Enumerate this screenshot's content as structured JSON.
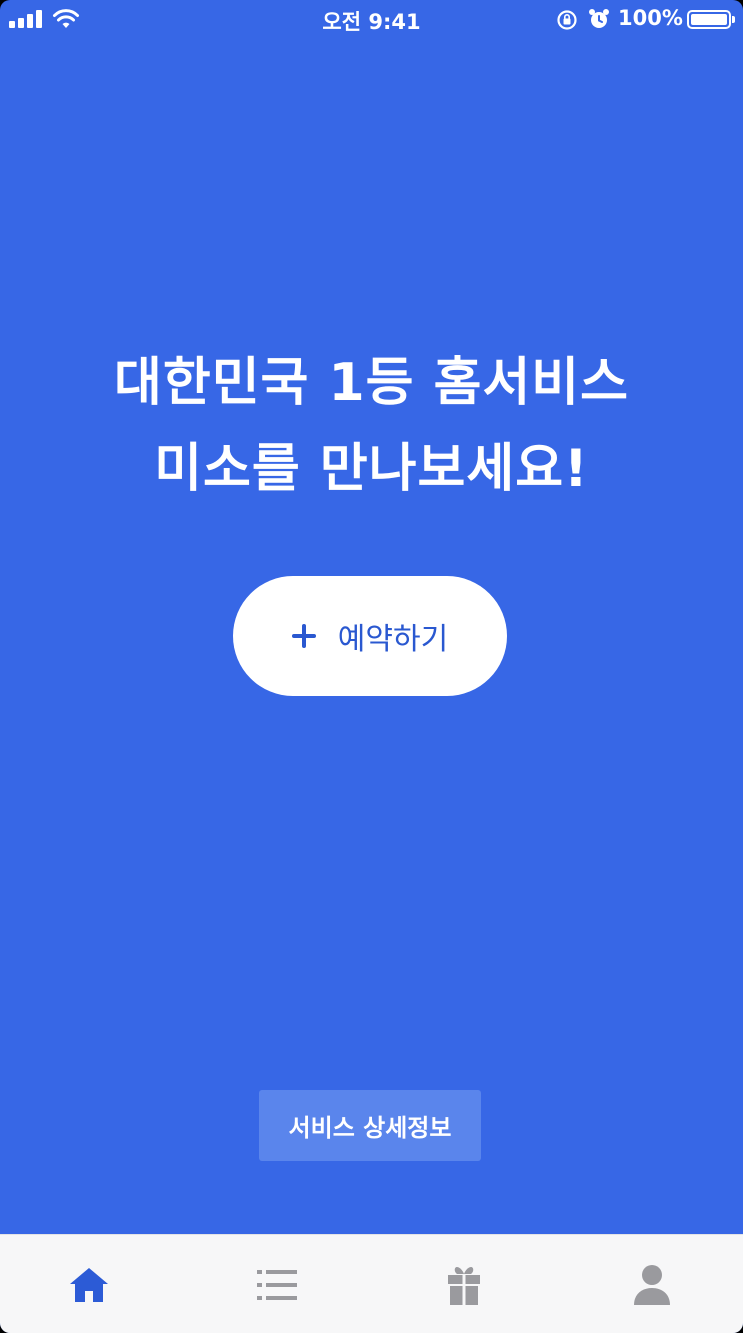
{
  "status_bar": {
    "time": "오전 9:41",
    "battery": "100%",
    "icons": [
      "signal-icon",
      "wifi-icon",
      "rotation-lock-icon",
      "alarm-icon",
      "battery-icon"
    ]
  },
  "hero": {
    "line1": "대한민국 1등 홈서비스",
    "line2": "미소를 만나보세요!"
  },
  "reserve_button": {
    "label": "예약하기",
    "icon": "plus-icon"
  },
  "detail_button": {
    "label": "서비스 상세정보"
  },
  "tab_bar": {
    "tabs": [
      {
        "icon": "home-icon",
        "active": true
      },
      {
        "icon": "list-icon",
        "active": false
      },
      {
        "icon": "gift-icon",
        "active": false
      },
      {
        "icon": "person-icon",
        "active": false
      }
    ]
  },
  "colors": {
    "background": "#3767e6",
    "accent": "#2a58d0",
    "detail_button": "#5a85ec",
    "tab_active": "#2c5bd6",
    "tab_inactive": "#9a9a9e"
  }
}
